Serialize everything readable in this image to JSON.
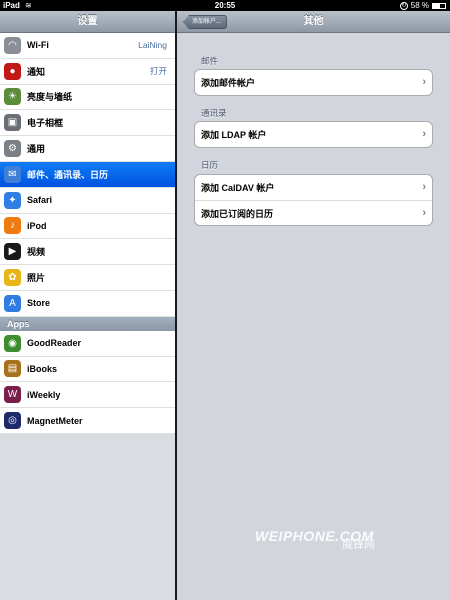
{
  "status_bar": {
    "carrier": "iPad",
    "time": "20:55",
    "battery": "58 %"
  },
  "master": {
    "title": "设置",
    "items": [
      {
        "label": "Wi-Fi",
        "detail": "LaiNing",
        "icon": "wifi-icon",
        "color": "#8a8f96"
      },
      {
        "label": "通知",
        "detail": "打开",
        "icon": "notifications-icon",
        "color": "#c21818"
      },
      {
        "label": "亮度与墙纸",
        "detail": "",
        "icon": "brightness-wallpaper-icon",
        "color": "#5b8c3a"
      },
      {
        "label": "电子相框",
        "detail": "",
        "icon": "picture-frame-icon",
        "color": "#6a6f75"
      },
      {
        "label": "通用",
        "detail": "",
        "icon": "gear-icon",
        "color": "#7b8087"
      },
      {
        "label": "邮件、通讯录、日历",
        "detail": "",
        "icon": "mail-icon",
        "color": "#3f7fd8"
      },
      {
        "label": "Safari",
        "detail": "",
        "icon": "safari-icon",
        "color": "#2f80e4"
      },
      {
        "label": "iPod",
        "detail": "",
        "icon": "ipod-icon",
        "color": "#ef7b10"
      },
      {
        "label": "视频",
        "detail": "",
        "icon": "video-icon",
        "color": "#1a1a1a"
      },
      {
        "label": "照片",
        "detail": "",
        "icon": "photos-icon",
        "color": "#e9b415"
      },
      {
        "label": "Store",
        "detail": "",
        "icon": "store-icon",
        "color": "#2f7de0"
      }
    ],
    "apps_header": "Apps",
    "apps": [
      {
        "label": "GoodReader",
        "icon": "goodreader-icon",
        "color": "#3c8d2e"
      },
      {
        "label": "iBooks",
        "icon": "ibooks-icon",
        "color": "#a8711b"
      },
      {
        "label": "iWeekly",
        "icon": "iweekly-icon",
        "color": "#7a1f4b"
      },
      {
        "label": "MagnetMeter",
        "icon": "magnetmeter-icon",
        "color": "#1f2a6b"
      }
    ]
  },
  "detail": {
    "back_label": "添加帐户...",
    "title": "其他",
    "groups": [
      {
        "header": "邮件",
        "cells": [
          "添加邮件帐户"
        ]
      },
      {
        "header": "通讯录",
        "cells": [
          "添加 LDAP 帐户"
        ]
      },
      {
        "header": "日历",
        "cells": [
          "添加 CalDAV 帐户",
          "添加已订阅的日历"
        ]
      }
    ]
  },
  "watermark": {
    "en": "WEIPHONE.COM",
    "cn": "威锋网"
  }
}
